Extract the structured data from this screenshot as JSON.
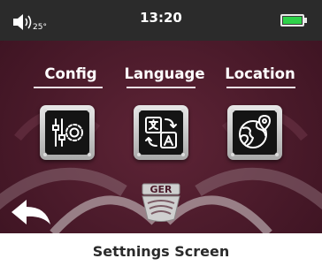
{
  "status_bar": {
    "volume_icon": "speaker-volume-icon",
    "temperature": "25°",
    "time": "13:20",
    "battery_icon": "battery-full-icon",
    "battery_color": "#2fd14a"
  },
  "menu": [
    {
      "label": "Config",
      "icon": "settings-sliders-gear-icon"
    },
    {
      "label": "Language",
      "icon": "translate-icon"
    },
    {
      "label": "Location",
      "icon": "globe-location-icon"
    }
  ],
  "back_icon": "back-arrow-icon",
  "logo_text": "GER",
  "caption": "Settnings Screen",
  "colors": {
    "background": "#4a1a2a",
    "status_bar": "#2b2b2b",
    "tile_frame": "#c8c8c8",
    "tile_inner": "#141414"
  }
}
